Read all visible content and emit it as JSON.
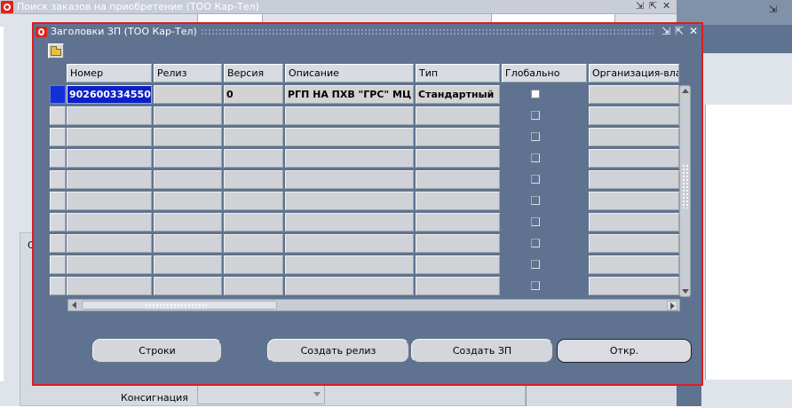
{
  "background_window": {
    "title": "Поиск заказов на приобретение (ТОО Кар-Тел)",
    "controls": [
      "⇲",
      "⇱",
      "✕"
    ],
    "form": {
      "partial_label": "С",
      "consignment_label": "Консигнация",
      "consignment_value": ""
    }
  },
  "modal": {
    "title": "Заголовки ЗП (ТОО Кар-Тел)",
    "controls": {
      "minimize": "⇲",
      "maximize": "⇱",
      "close": "✕"
    },
    "toolbar": {
      "open_folder_icon": "folder-open-icon"
    },
    "grid": {
      "columns": [
        "Номер",
        "Релиз",
        "Версия",
        "Описание",
        "Тип",
        "Глобально",
        "Организация-вла"
      ],
      "rows": [
        {
          "number": "902600334550",
          "release": "",
          "version": "0",
          "description": "РГП НА ПХВ \"ГРС\" МЦ",
          "type": "Стандартный",
          "global": false,
          "org": ""
        },
        {
          "number": "",
          "release": "",
          "version": "",
          "description": "",
          "type": "",
          "global": false,
          "org": ""
        },
        {
          "number": "",
          "release": "",
          "version": "",
          "description": "",
          "type": "",
          "global": false,
          "org": ""
        },
        {
          "number": "",
          "release": "",
          "version": "",
          "description": "",
          "type": "",
          "global": false,
          "org": ""
        },
        {
          "number": "",
          "release": "",
          "version": "",
          "description": "",
          "type": "",
          "global": false,
          "org": ""
        },
        {
          "number": "",
          "release": "",
          "version": "",
          "description": "",
          "type": "",
          "global": false,
          "org": ""
        },
        {
          "number": "",
          "release": "",
          "version": "",
          "description": "",
          "type": "",
          "global": false,
          "org": ""
        },
        {
          "number": "",
          "release": "",
          "version": "",
          "description": "",
          "type": "",
          "global": false,
          "org": ""
        },
        {
          "number": "",
          "release": "",
          "version": "",
          "description": "",
          "type": "",
          "global": false,
          "org": ""
        },
        {
          "number": "",
          "release": "",
          "version": "",
          "description": "",
          "type": "",
          "global": false,
          "org": ""
        }
      ]
    },
    "buttons": {
      "lines": "Строки",
      "create_release": "Создать релиз",
      "create_po": "Создать ЗП",
      "open": "Откр."
    },
    "colors": {
      "border": "#e01b22",
      "frame": "#5f7391",
      "selection": "#0a1fc6"
    }
  }
}
